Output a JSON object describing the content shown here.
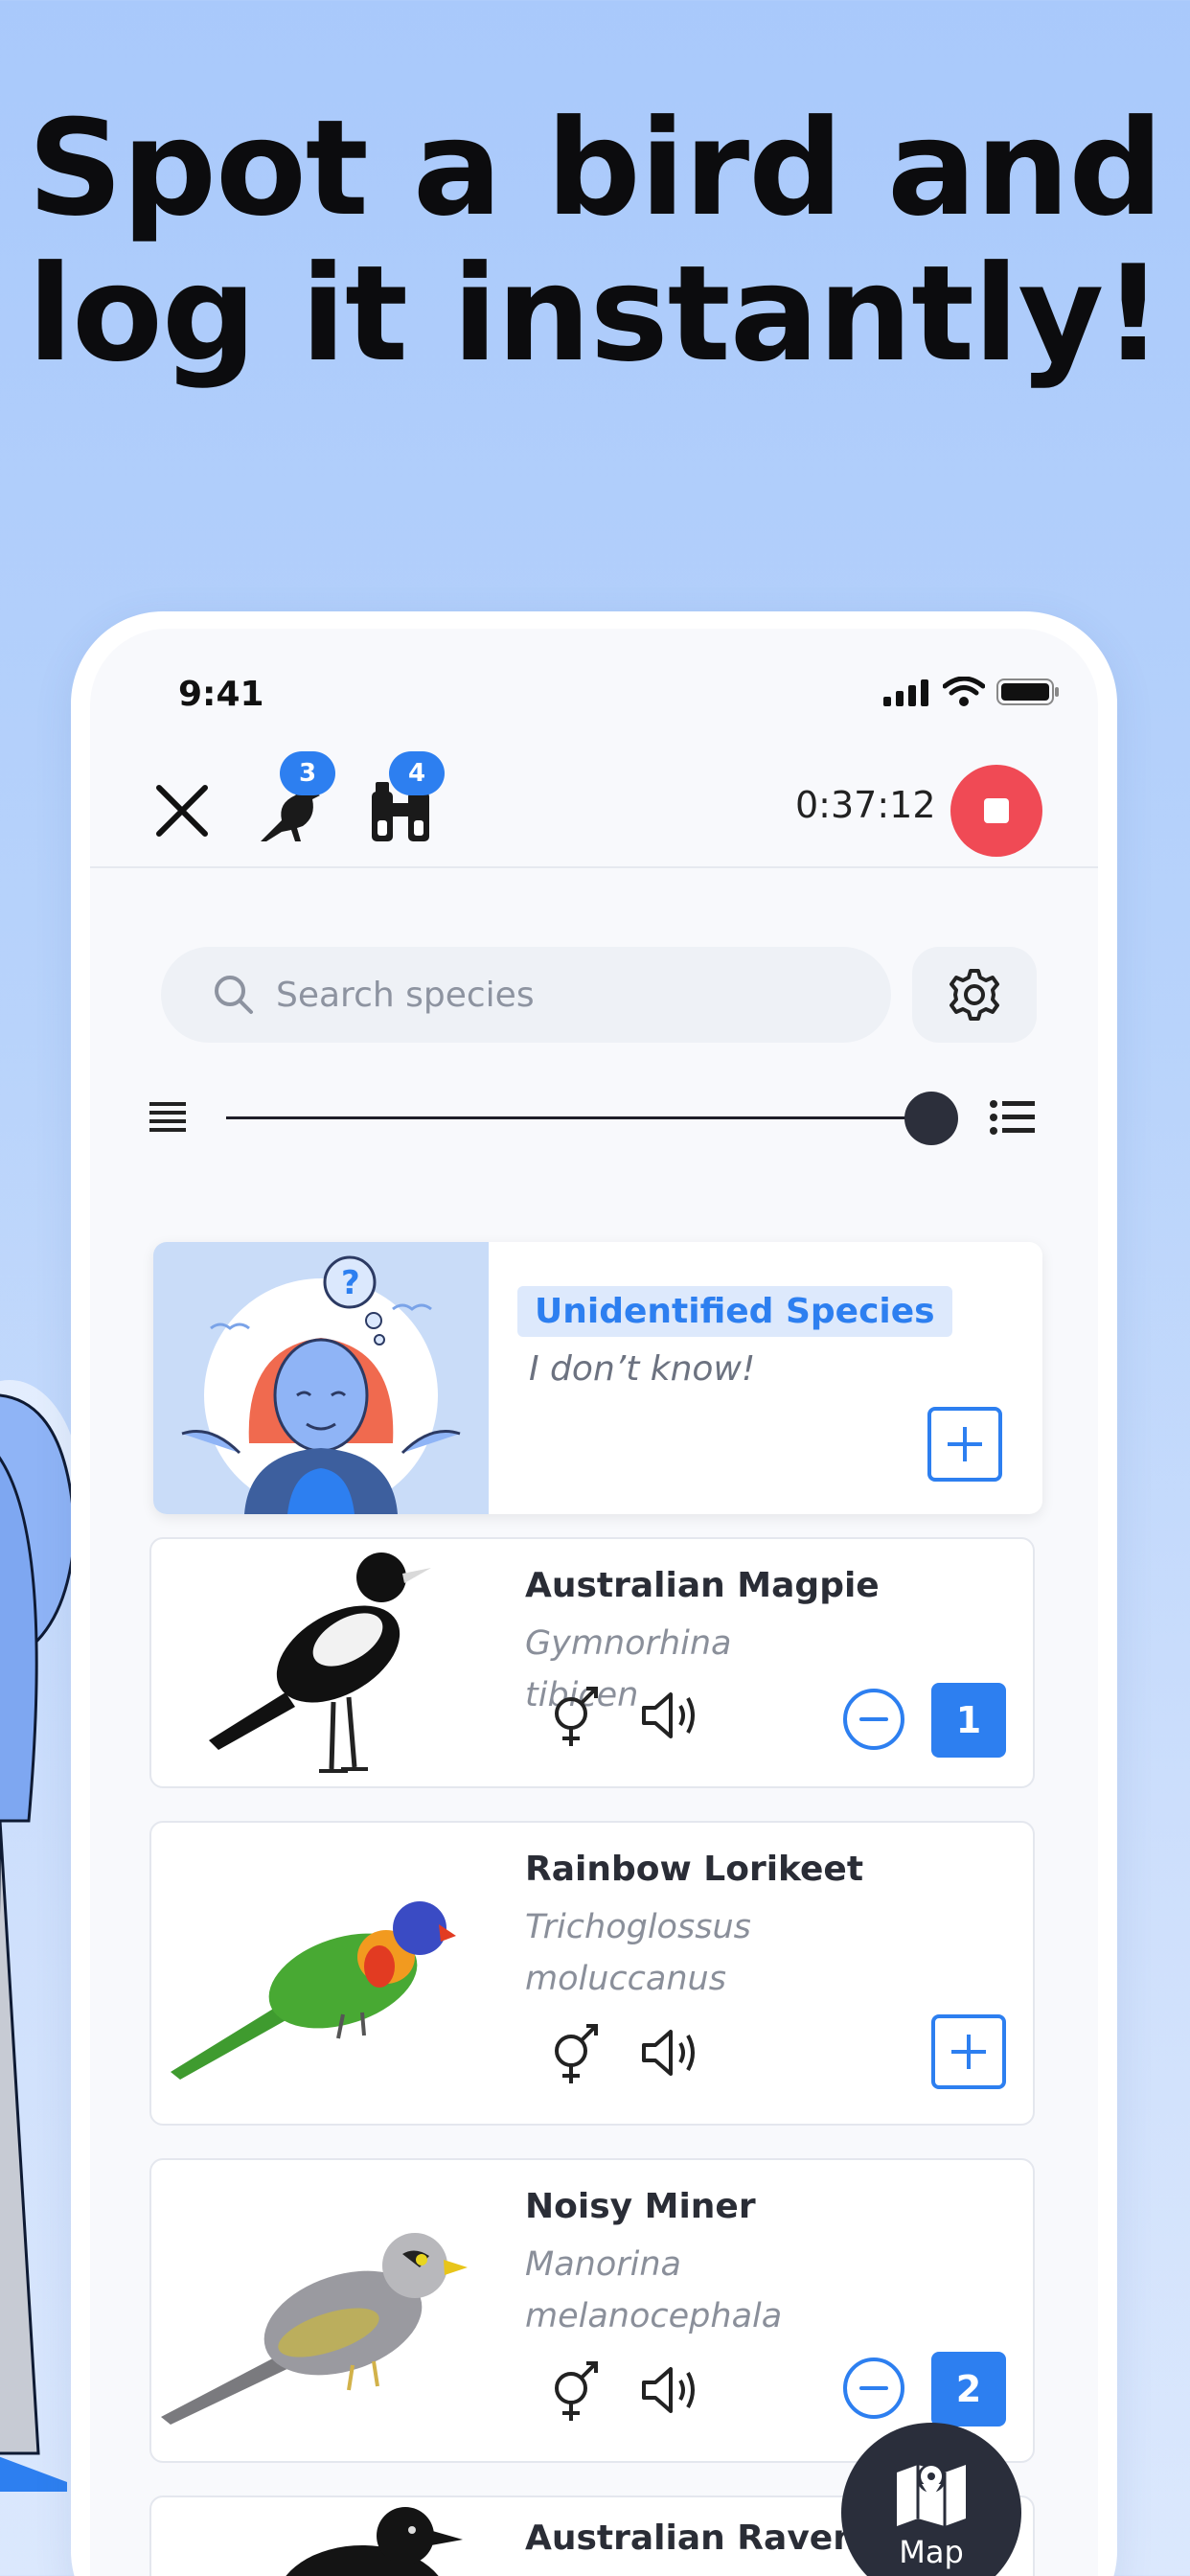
{
  "headline": {
    "line1": "Spot a bird and",
    "line2": "log it instantly!"
  },
  "status_bar": {
    "time": "9:41"
  },
  "top_bar": {
    "species_badge": "3",
    "sightings_badge": "4",
    "timer": "0:37:12"
  },
  "search": {
    "placeholder": "Search species"
  },
  "density_slider": {
    "value": 1.0
  },
  "unidentified": {
    "tag": "Unidentified Species",
    "subtitle": "I don’t know!"
  },
  "species": [
    {
      "name": "Australian Magpie",
      "scientific": "Gymnorhina tibicen",
      "count": "1"
    },
    {
      "name": "Rainbow Lorikeet",
      "scientific": "Trichoglossus moluccanus",
      "count": ""
    },
    {
      "name": "Noisy Miner",
      "scientific": "Manorina melanocephala",
      "count": "2"
    },
    {
      "name": "Australian Raven",
      "scientific": "",
      "count": ""
    }
  ],
  "map_button": {
    "label": "Map"
  },
  "colors": {
    "accent": "#2d7ff0",
    "stop": "#f04a55",
    "dark": "#2a2e3b"
  },
  "icons": [
    "close-icon",
    "bird-icon",
    "binoculars-icon",
    "stop-icon",
    "search-icon",
    "gear-icon",
    "list-compact-icon",
    "list-detailed-icon",
    "gender-icon",
    "speaker-icon",
    "plus-icon",
    "minus-icon",
    "map-icon"
  ]
}
